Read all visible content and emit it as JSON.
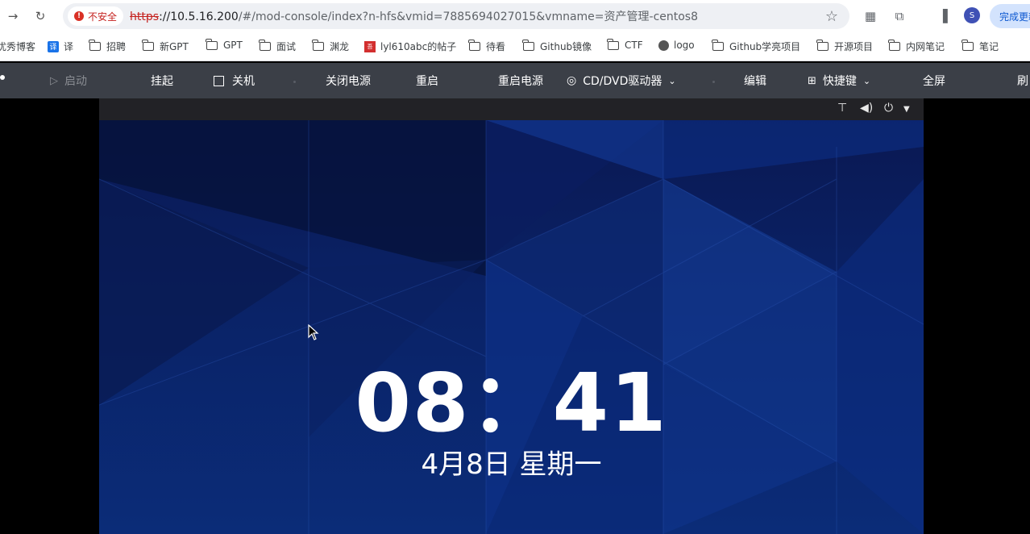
{
  "browser": {
    "security_label": "不安全",
    "url_scheme": "https",
    "url_host": "://10.5.16.200",
    "url_rest": "/#/mod-console/index?n-hfs&vmid=7885694027015&vmname=资产管理-centos8",
    "profile_initial": "S",
    "update_button": "完成更新"
  },
  "bookmarks": [
    {
      "label": "优秀博客",
      "icon": "none"
    },
    {
      "label": "译",
      "icon": "translate-icon"
    },
    {
      "label": "招聘",
      "icon": "folder-icon"
    },
    {
      "label": "新GPT",
      "icon": "folder-icon"
    },
    {
      "label": "GPT",
      "icon": "folder-icon"
    },
    {
      "label": "面试",
      "icon": "folder-icon"
    },
    {
      "label": "渊龙",
      "icon": "folder-icon"
    },
    {
      "label": "lyl610abc的帖子",
      "icon": "site-icon"
    },
    {
      "label": "待看",
      "icon": "folder-icon"
    },
    {
      "label": "Github镜像",
      "icon": "folder-icon"
    },
    {
      "label": "CTF",
      "icon": "folder-icon"
    },
    {
      "label": "logo",
      "icon": "globe-icon"
    },
    {
      "label": "Github学亮项目",
      "icon": "folder-icon"
    },
    {
      "label": "开源项目",
      "icon": "folder-icon"
    },
    {
      "label": "内网笔记",
      "icon": "folder-icon"
    },
    {
      "label": "笔记",
      "icon": "folder-icon"
    }
  ],
  "console_menu": {
    "start": "启动",
    "suspend": "挂起",
    "shutdown": "关机",
    "power_off": "关闭电源",
    "restart": "重启",
    "power_restart": "重启电源",
    "cd_dvd": "CD/DVD驱动器",
    "edit": "编辑",
    "shortcut": "快捷键",
    "fullscreen": "全屏",
    "refresh": "刷"
  },
  "vm": {
    "time": "08：41",
    "date": "4月8日 星期一"
  }
}
